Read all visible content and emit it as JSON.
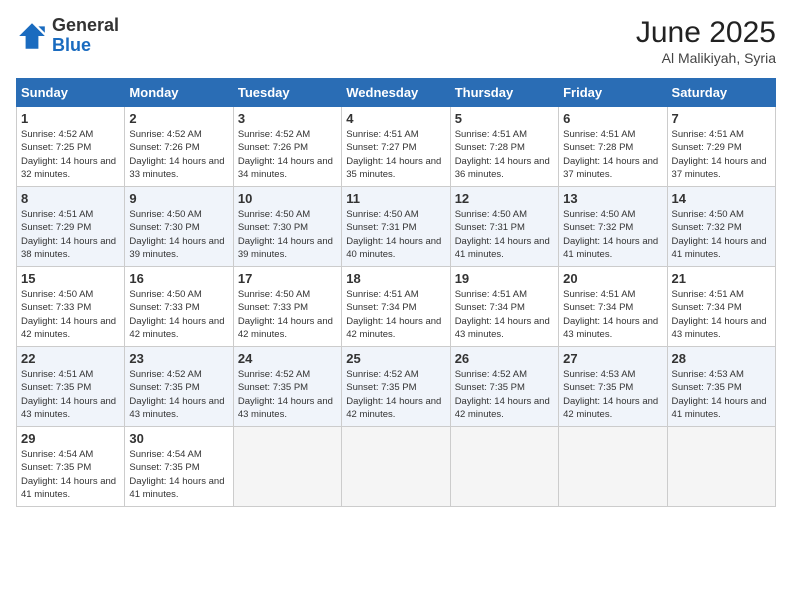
{
  "logo": {
    "general": "General",
    "blue": "Blue"
  },
  "title": "June 2025",
  "location": "Al Malikiyah, Syria",
  "headers": [
    "Sunday",
    "Monday",
    "Tuesday",
    "Wednesday",
    "Thursday",
    "Friday",
    "Saturday"
  ],
  "weeks": [
    [
      {
        "day": "1",
        "sunrise": "4:52 AM",
        "sunset": "7:25 PM",
        "daylight": "14 hours and 32 minutes."
      },
      {
        "day": "2",
        "sunrise": "4:52 AM",
        "sunset": "7:26 PM",
        "daylight": "14 hours and 33 minutes."
      },
      {
        "day": "3",
        "sunrise": "4:52 AM",
        "sunset": "7:26 PM",
        "daylight": "14 hours and 34 minutes."
      },
      {
        "day": "4",
        "sunrise": "4:51 AM",
        "sunset": "7:27 PM",
        "daylight": "14 hours and 35 minutes."
      },
      {
        "day": "5",
        "sunrise": "4:51 AM",
        "sunset": "7:28 PM",
        "daylight": "14 hours and 36 minutes."
      },
      {
        "day": "6",
        "sunrise": "4:51 AM",
        "sunset": "7:28 PM",
        "daylight": "14 hours and 37 minutes."
      },
      {
        "day": "7",
        "sunrise": "4:51 AM",
        "sunset": "7:29 PM",
        "daylight": "14 hours and 37 minutes."
      }
    ],
    [
      {
        "day": "8",
        "sunrise": "4:51 AM",
        "sunset": "7:29 PM",
        "daylight": "14 hours and 38 minutes."
      },
      {
        "day": "9",
        "sunrise": "4:50 AM",
        "sunset": "7:30 PM",
        "daylight": "14 hours and 39 minutes."
      },
      {
        "day": "10",
        "sunrise": "4:50 AM",
        "sunset": "7:30 PM",
        "daylight": "14 hours and 39 minutes."
      },
      {
        "day": "11",
        "sunrise": "4:50 AM",
        "sunset": "7:31 PM",
        "daylight": "14 hours and 40 minutes."
      },
      {
        "day": "12",
        "sunrise": "4:50 AM",
        "sunset": "7:31 PM",
        "daylight": "14 hours and 41 minutes."
      },
      {
        "day": "13",
        "sunrise": "4:50 AM",
        "sunset": "7:32 PM",
        "daylight": "14 hours and 41 minutes."
      },
      {
        "day": "14",
        "sunrise": "4:50 AM",
        "sunset": "7:32 PM",
        "daylight": "14 hours and 41 minutes."
      }
    ],
    [
      {
        "day": "15",
        "sunrise": "4:50 AM",
        "sunset": "7:33 PM",
        "daylight": "14 hours and 42 minutes."
      },
      {
        "day": "16",
        "sunrise": "4:50 AM",
        "sunset": "7:33 PM",
        "daylight": "14 hours and 42 minutes."
      },
      {
        "day": "17",
        "sunrise": "4:50 AM",
        "sunset": "7:33 PM",
        "daylight": "14 hours and 42 minutes."
      },
      {
        "day": "18",
        "sunrise": "4:51 AM",
        "sunset": "7:34 PM",
        "daylight": "14 hours and 42 minutes."
      },
      {
        "day": "19",
        "sunrise": "4:51 AM",
        "sunset": "7:34 PM",
        "daylight": "14 hours and 43 minutes."
      },
      {
        "day": "20",
        "sunrise": "4:51 AM",
        "sunset": "7:34 PM",
        "daylight": "14 hours and 43 minutes."
      },
      {
        "day": "21",
        "sunrise": "4:51 AM",
        "sunset": "7:34 PM",
        "daylight": "14 hours and 43 minutes."
      }
    ],
    [
      {
        "day": "22",
        "sunrise": "4:51 AM",
        "sunset": "7:35 PM",
        "daylight": "14 hours and 43 minutes."
      },
      {
        "day": "23",
        "sunrise": "4:52 AM",
        "sunset": "7:35 PM",
        "daylight": "14 hours and 43 minutes."
      },
      {
        "day": "24",
        "sunrise": "4:52 AM",
        "sunset": "7:35 PM",
        "daylight": "14 hours and 43 minutes."
      },
      {
        "day": "25",
        "sunrise": "4:52 AM",
        "sunset": "7:35 PM",
        "daylight": "14 hours and 42 minutes."
      },
      {
        "day": "26",
        "sunrise": "4:52 AM",
        "sunset": "7:35 PM",
        "daylight": "14 hours and 42 minutes."
      },
      {
        "day": "27",
        "sunrise": "4:53 AM",
        "sunset": "7:35 PM",
        "daylight": "14 hours and 42 minutes."
      },
      {
        "day": "28",
        "sunrise": "4:53 AM",
        "sunset": "7:35 PM",
        "daylight": "14 hours and 41 minutes."
      }
    ],
    [
      {
        "day": "29",
        "sunrise": "4:54 AM",
        "sunset": "7:35 PM",
        "daylight": "14 hours and 41 minutes."
      },
      {
        "day": "30",
        "sunrise": "4:54 AM",
        "sunset": "7:35 PM",
        "daylight": "14 hours and 41 minutes."
      },
      null,
      null,
      null,
      null,
      null
    ]
  ]
}
